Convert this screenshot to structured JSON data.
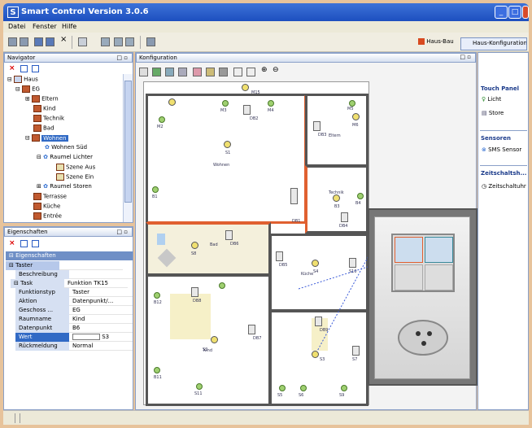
{
  "window": {
    "title": "Smart Control  Version 3.0.6",
    "logo": "S"
  },
  "menu": [
    "Datei",
    "Fenster",
    "Hilfe"
  ],
  "perspectives": {
    "hausbau": "Haus-Bau",
    "konfig": "Haus-Konfiguration"
  },
  "navigator": {
    "title": "Navigator",
    "tree": [
      {
        "label": "Haus"
      },
      {
        "label": "EG"
      },
      {
        "label": "Eltern"
      },
      {
        "label": "Kind"
      },
      {
        "label": "Technik"
      },
      {
        "label": "Bad"
      },
      {
        "label": "Wohnen",
        "selected": true
      },
      {
        "label": "Wohnen Süd"
      },
      {
        "label": "Raumel Lichter"
      },
      {
        "label": "Szene Aus"
      },
      {
        "label": "Szene Ein"
      },
      {
        "label": "Raumel Storen"
      },
      {
        "label": "Terrasse"
      },
      {
        "label": "Küche"
      },
      {
        "label": "Entrée"
      }
    ]
  },
  "properties": {
    "title": "Eigenschaften",
    "section": "Eigenschaften",
    "rows": [
      {
        "key": "Taster",
        "value": ""
      },
      {
        "key": "Beschreibung",
        "value": ""
      },
      {
        "key": "Task",
        "value": "Funktion TK15"
      },
      {
        "key": "Funktionstyp",
        "value": "Taster"
      },
      {
        "key": "Aktion",
        "value": "Datenpunkt/..."
      },
      {
        "key": "Geschoss ...",
        "value": "EG"
      },
      {
        "key": "Raumname",
        "value": "Kind"
      },
      {
        "key": "Datenpunkt",
        "value": "B6"
      },
      {
        "key": "Wert",
        "value": "S3",
        "selected": true
      },
      {
        "key": "Rückmeldung",
        "value": "Normal"
      }
    ]
  },
  "config": {
    "title": "Konfiguration",
    "rooms": {
      "wohnen": "Wohnen",
      "kind": "Kind",
      "technik": "Technik",
      "bad": "Bad",
      "kueche": "Küche",
      "eltern": "Eltern"
    },
    "devices": [
      "M15",
      "M2",
      "M3",
      "M4",
      "M5",
      "M6",
      "DB1",
      "DB2",
      "DB3",
      "DB4",
      "DB5",
      "DB6",
      "DB7",
      "DB8",
      "DB9",
      "B1",
      "B2",
      "B3",
      "B4",
      "B5",
      "B6",
      "B10",
      "B11",
      "B12",
      "S1",
      "S2",
      "S3",
      "S4",
      "S5",
      "S6",
      "S7",
      "S8",
      "S9",
      "S10",
      "S11"
    ]
  },
  "palette": {
    "touch_panel": {
      "title": "Touch Panel",
      "items": [
        "Licht",
        "Store"
      ]
    },
    "sensoren": {
      "title": "Sensoren",
      "items": [
        "SMS Sensor"
      ]
    },
    "zeitschalt": {
      "title": "Zeitschaltsh...",
      "items": [
        "Zeitschaltuhr"
      ]
    }
  },
  "colors": {
    "titlebar": "#1d4fbf",
    "highlight": "#316ac5",
    "wall": "#555555",
    "accent_room": "#e06030",
    "panel_border": "#8aa0c8"
  }
}
